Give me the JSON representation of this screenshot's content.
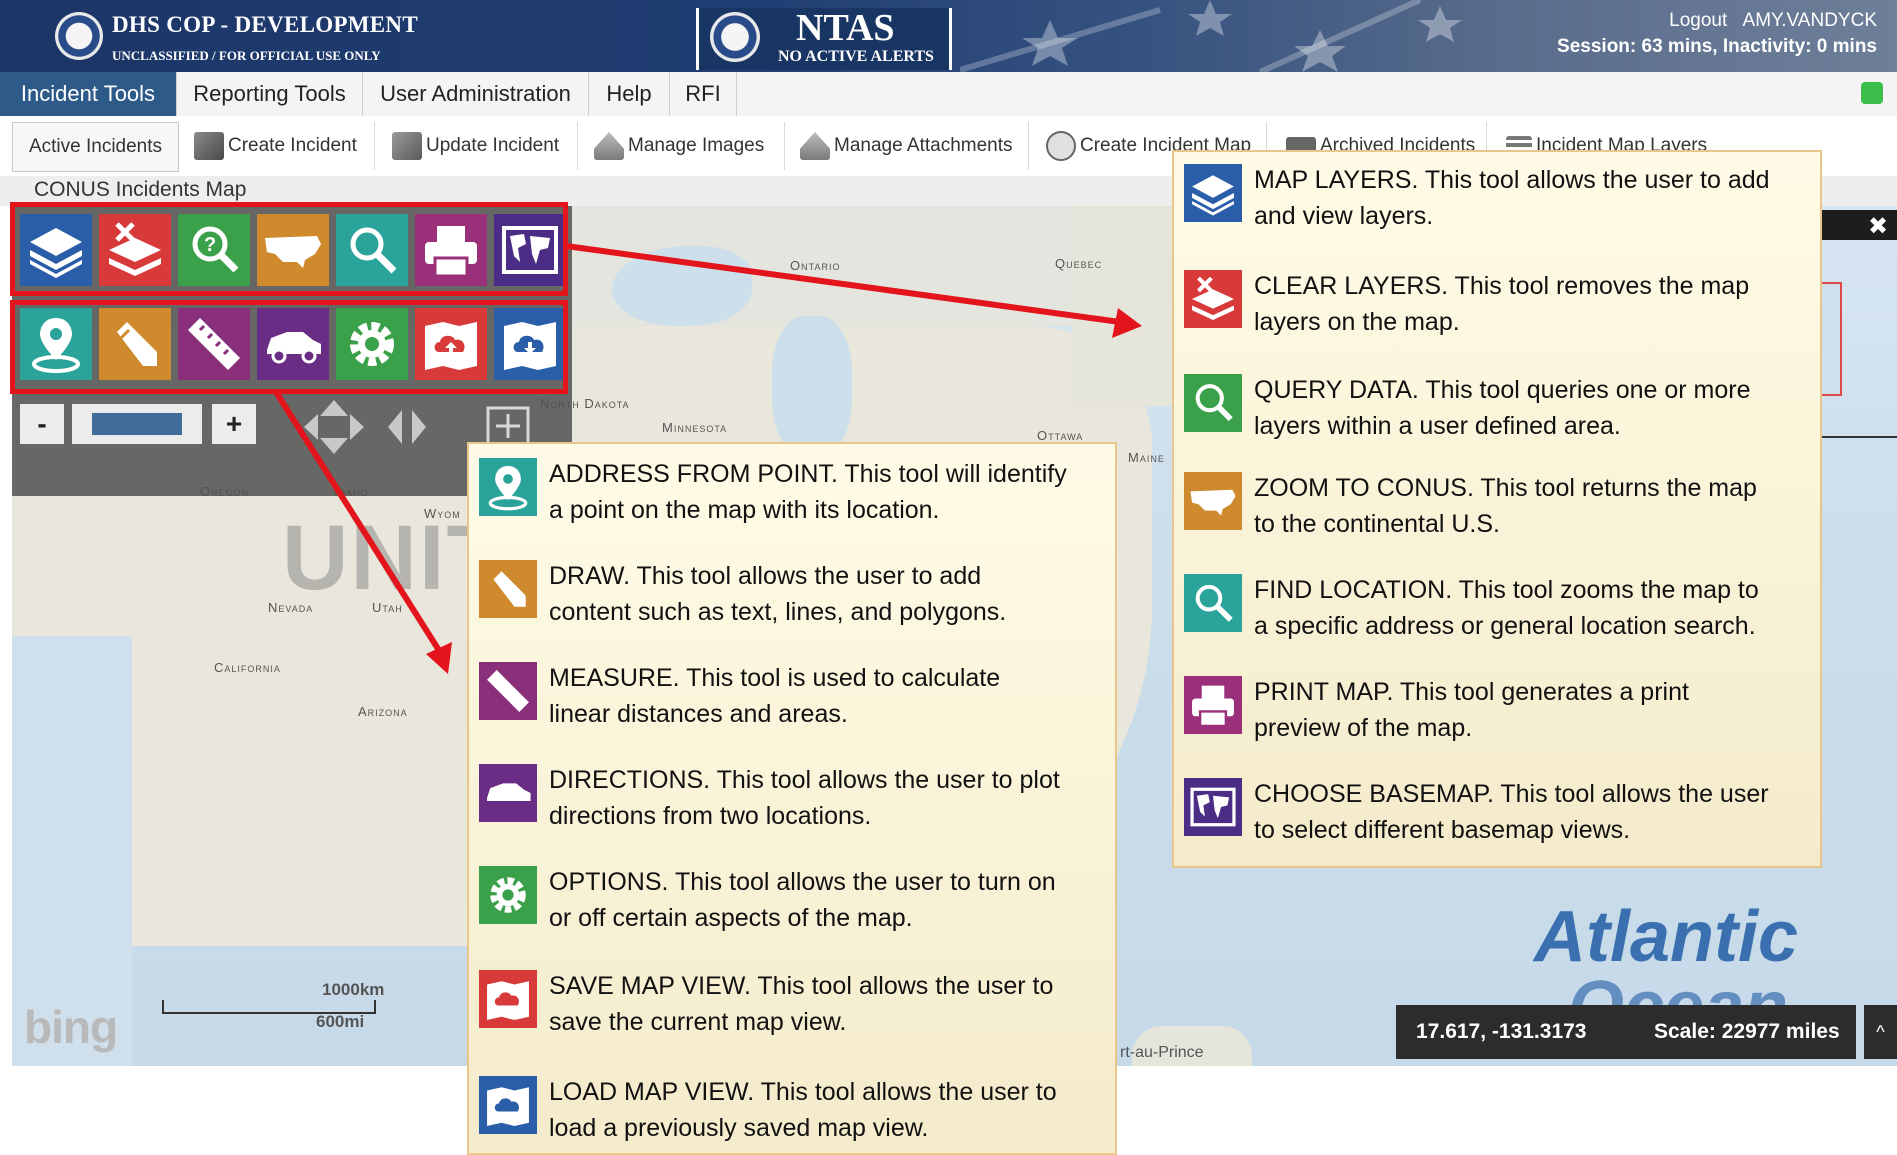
{
  "header": {
    "app_title": "DHS COP - DEVELOPMENT",
    "classification": "UNCLASSIFIED / FOR OFFICIAL USE ONLY",
    "ntas_title": "NTAS",
    "ntas_status": "NO ACTIVE ALERTS",
    "logout_label": "Logout",
    "user_name": "AMY.VANDYCK",
    "session_text": "Session: 63 mins, Inactivity: 0 mins"
  },
  "main_nav": {
    "tabs": [
      {
        "label": "Incident Tools",
        "active": true
      },
      {
        "label": "Reporting Tools"
      },
      {
        "label": "User Administration"
      },
      {
        "label": "Help"
      },
      {
        "label": "RFI"
      }
    ]
  },
  "toolbar": {
    "items": [
      {
        "label": "Active Incidents",
        "icon": "none"
      },
      {
        "label": "Create Incident",
        "icon": "create-incident-icon"
      },
      {
        "label": "Update Incident",
        "icon": "update-incident-icon"
      },
      {
        "label": "Manage Images",
        "icon": "manage-images-icon"
      },
      {
        "label": "Manage Attachments",
        "icon": "manage-attachments-icon"
      },
      {
        "label": "Create Incident Map",
        "icon": "globe-icon"
      },
      {
        "label": "Archived Incidents",
        "icon": "archive-icon"
      },
      {
        "label": "Incident Map Layers",
        "icon": "layers-icon"
      }
    ]
  },
  "map": {
    "title": "CONUS Incidents Map",
    "labels": {
      "ontario": "Ontario",
      "quebec": "Quebec",
      "north_dakota": "North Dakota",
      "minnesota": "Minnesota",
      "oregon": "Oregon",
      "nevada": "Nevada",
      "california": "California",
      "arizona": "Arizona",
      "maine": "Maine",
      "ottawa": "Ottawa",
      "wyoming_partial": "Wyom",
      "utah_partial": "Utah",
      "idaho_partial": "Idaho",
      "port_au_prince": "rt-au-Prince"
    },
    "big_label": "UNIT",
    "ocean_label": "Atlantic",
    "ocean_label_2": "Ocean",
    "scale_km": "1000km",
    "scale_mi": "600mi",
    "provider": "bing",
    "coordinates": "17.617, -131.3173",
    "scale": "Scale: 22977 miles",
    "collapse_glyph": "^"
  },
  "tools_row_1": [
    {
      "name": "map-layers-tool",
      "icon": "layers-icon",
      "color": "#2a5ea8"
    },
    {
      "name": "clear-layers-tool",
      "icon": "clear-layers-icon",
      "color": "#d83a3a"
    },
    {
      "name": "query-data-tool",
      "icon": "query-icon",
      "color": "#3aa14a"
    },
    {
      "name": "zoom-to-conus-tool",
      "icon": "usa-map-icon",
      "color": "#cf8a2e"
    },
    {
      "name": "find-location-tool",
      "icon": "search-icon",
      "color": "#2aa39a"
    },
    {
      "name": "print-map-tool",
      "icon": "printer-icon",
      "color": "#9a2f7a"
    },
    {
      "name": "choose-basemap-tool",
      "icon": "world-map-icon",
      "color": "#4b2d86"
    }
  ],
  "tools_row_2": [
    {
      "name": "address-from-point-tool",
      "icon": "map-pin-icon",
      "color": "#2aa39a"
    },
    {
      "name": "draw-tool",
      "icon": "pencil-icon",
      "color": "#cf8a2e"
    },
    {
      "name": "measure-tool",
      "icon": "ruler-icon",
      "color": "#8a2f7a"
    },
    {
      "name": "directions-tool",
      "icon": "car-icon",
      "color": "#6a2d86"
    },
    {
      "name": "options-tool",
      "icon": "gear-icon",
      "color": "#3aa14a"
    },
    {
      "name": "save-map-view-tool",
      "icon": "cloud-upload-icon",
      "color": "#d83a3a"
    },
    {
      "name": "load-map-view-tool",
      "icon": "cloud-download-icon",
      "color": "#2a5ea8"
    }
  ],
  "zoom": {
    "minus": "-",
    "plus": "+"
  },
  "callout_left": [
    {
      "line1": "ADDRESS FROM POINT.  This tool will identify",
      "line2": "a point on the map with its location."
    },
    {
      "line1": "DRAW. This tool allows the user to add",
      "line2": "content such as text, lines, and polygons."
    },
    {
      "line1": "MEASURE. This tool is used to calculate",
      "line2": "linear distances and areas."
    },
    {
      "line1": "DIRECTIONS. This tool allows the user to plot",
      "line2": "directions from two locations."
    },
    {
      "line1": "OPTIONS. This tool allows the user to turn on",
      "line2": "or off certain aspects of the map."
    },
    {
      "line1": "SAVE MAP VIEW. This tool allows the user to",
      "line2": "save the current map view."
    },
    {
      "line1": "LOAD MAP VIEW.  This tool allows the user to",
      "line2": "load a previously saved map view."
    }
  ],
  "callout_right": [
    {
      "line1": "MAP LAYERS.  This tool allows the user to add",
      "line2": "and view layers."
    },
    {
      "line1": "CLEAR LAYERS. This tool removes the map",
      "line2": "layers on the map."
    },
    {
      "line1": "QUERY DATA. This tool queries one or more",
      "line2": "layers  within a user defined area."
    },
    {
      "line1": "ZOOM TO CONUS. This tool returns the map",
      "line2": "to the continental U.S."
    },
    {
      "line1": "FIND LOCATION. This tool zooms the map to",
      "line2": "a specific address or general location search."
    },
    {
      "line1": "PRINT MAP. This tool generates a print",
      "line2": "preview of the map."
    },
    {
      "line1": "CHOOSE BASEMAP.  This tool allows the user",
      "line2": "to select different basemap views."
    }
  ],
  "colors": {
    "accent_red": "#e3141b",
    "header_blue": "#1b3566",
    "active_tab": "#2e5a8a",
    "status_green": "#3bbf4a"
  }
}
